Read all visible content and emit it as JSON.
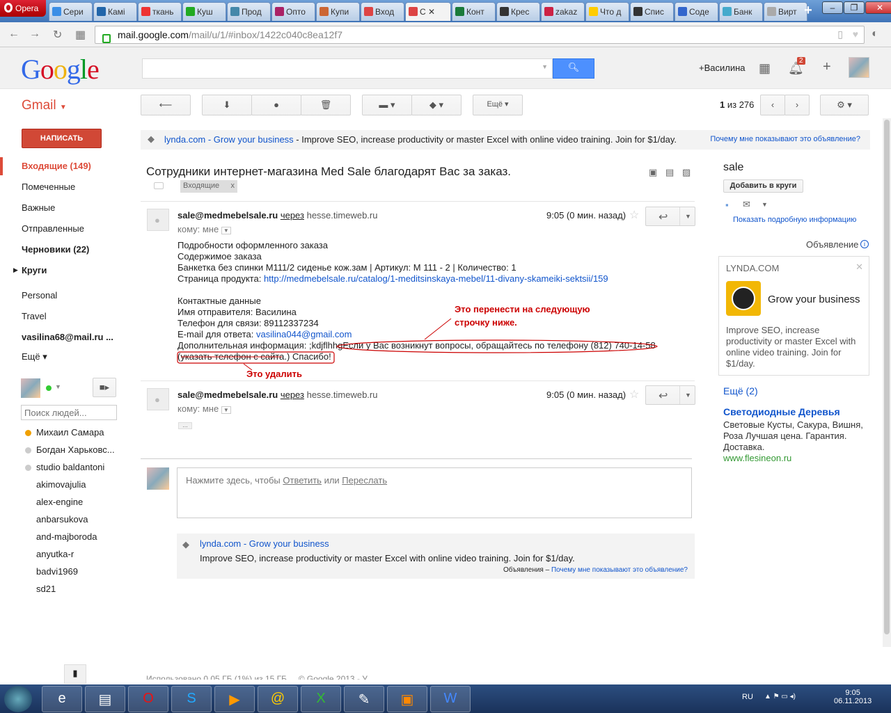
{
  "browser": {
    "opera_label": "Opera",
    "tabs": [
      {
        "label": "Сери",
        "color": "#3a8ee6"
      },
      {
        "label": "Камі",
        "color": "#2266aa"
      },
      {
        "label": "ткань",
        "color": "#e33"
      },
      {
        "label": "Куш",
        "color": "#2a2"
      },
      {
        "label": "Прод",
        "color": "#48a"
      },
      {
        "label": "Опто",
        "color": "#a26"
      },
      {
        "label": "Купи",
        "color": "#c63"
      },
      {
        "label": "Вход",
        "color": "#d44"
      },
      {
        "label": "C",
        "color": "#d44"
      },
      {
        "label": "Конт",
        "color": "#1a7a3a"
      },
      {
        "label": "Крес",
        "color": "#333"
      },
      {
        "label": "zakaz",
        "color": "#c24"
      },
      {
        "label": "Что д",
        "color": "#fc0"
      },
      {
        "label": "Спис",
        "color": "#333"
      },
      {
        "label": "Соде",
        "color": "#36c"
      },
      {
        "label": "Банк",
        "color": "#4ac"
      },
      {
        "label": "Вирт",
        "color": "#aaa"
      }
    ],
    "url_host": "mail.google.com",
    "url_path": "/mail/u/1/#inbox/1422c040c8ea12f7"
  },
  "header": {
    "logo": "Google",
    "user": "+Василина",
    "notifications": "2"
  },
  "toolbar": {
    "gmail": "Gmail",
    "more": "Ещё",
    "counter_a": "1",
    "counter_b": "из 276"
  },
  "sidebar": {
    "compose": "НАПИСАТЬ",
    "items": [
      {
        "label": "Входящие (149)"
      },
      {
        "label": "Помеченные"
      },
      {
        "label": "Важные"
      },
      {
        "label": "Отправленные"
      },
      {
        "label": "Черновики (22)"
      },
      {
        "label": "Круги"
      },
      {
        "label": "Personal"
      },
      {
        "label": "Travel"
      },
      {
        "label": "vasilina68@mail.ru ..."
      },
      {
        "label": "Ещё"
      }
    ],
    "people_placeholder": "Поиск людей...",
    "contacts": [
      "Михаил Самара",
      "Богдан Харьковс...",
      "studio baldantoni",
      "akimovajulia",
      "alex-engine",
      "anbarsukova",
      "and-majboroda",
      "anyutka-r",
      "badvi1969",
      "sd21"
    ]
  },
  "ad_top": {
    "link": "lynda.com - Grow your business",
    "text": " - Improve SEO, increase productivity or master Excel with online video training. Join for $1/day.",
    "why": "Почему мне показывают это объявление?"
  },
  "thread": {
    "subject": "Сотрудники интернет-магазина Med Sale благодарят Вас за заказ.",
    "label": "Входящие"
  },
  "message1": {
    "sender": "sale@medmebelsale.ru",
    "via": "через",
    "via_host": "hesse.timeweb.ru",
    "time": "9:05 (0 мин. назад)",
    "to": "кому: мне",
    "lines": [
      "Подробности оформленного заказа",
      "Содержимое заказа",
      "Банкетка без спинки  М111/2 сиденье кож.зам |  Артикул: М 111 - 2 | Количество: 1"
    ],
    "product_label": "Страница продукта: ",
    "product_link": "http://medmebelsale.ru/catalog/1-meditsinskaya-mebel/11-divany-skameiki-sektsii/159",
    "contacts_title": "Контактные данные",
    "sender_name": "Имя отправителя: Василина",
    "phone": "Телефон для связи: 89112337234",
    "email_label": "E-mail для ответа: ",
    "email_link": "vasilina044@gmail.com",
    "extra_a": "Дополнительная информация: ;kdjflhhg",
    "extra_b": "Если у Вас возникнут вопросы, обращайтесь по телефону (812) 740-14-58",
    "extra_c": "(указать телефон с сайта.",
    "extra_d": ") Спасибо!"
  },
  "annotations": {
    "move_1": "Это перенести на следующую",
    "move_2": "строчку ниже.",
    "delete": "Это удалить"
  },
  "message2": {
    "sender": "sale@medmebelsale.ru",
    "via": "через",
    "via_host": "hesse.timeweb.ru",
    "time": "9:05 (0 мин. назад)",
    "to": "кому: мне",
    "dots": "..."
  },
  "reply": {
    "prompt": "Нажмите здесь, чтобы ",
    "reply_link": "Ответить",
    "or": " или ",
    "forward_link": "Переслать"
  },
  "ad_bottom": {
    "title": "lynda.com - Grow your business",
    "text": "Improve SEO, increase productivity or master Excel with online video training. Join for $1/day.",
    "ads_label": "Объявления – ",
    "why": "Почему мне показывают это объявление?"
  },
  "right": {
    "contact_name": "sale",
    "add_circles": "Добавить в круги",
    "show_info": "Показать подробную информацию",
    "ad_label": "Объявление",
    "card_brand": "LYNDA.COM",
    "card_title": "Grow your business",
    "card_text": "Improve SEO, increase productivity or master Excel with online video training. Join for $1/day.",
    "more": "Ещё (2)",
    "ad2_title": "Светодиодные Деревья",
    "ad2_text": "Световые Кусты, Сакура, Вишня, Роза Лучшая цена. Гарантия. Доставка.",
    "ad2_url": "www.flesineon.ru"
  },
  "footer_partial": "Использовано 0,05 ГБ (1%) из 15 ГБ ... © Google 2013 - У",
  "taskbar": {
    "lang": "RU",
    "time": "9:05",
    "date": "06.11.2013"
  }
}
